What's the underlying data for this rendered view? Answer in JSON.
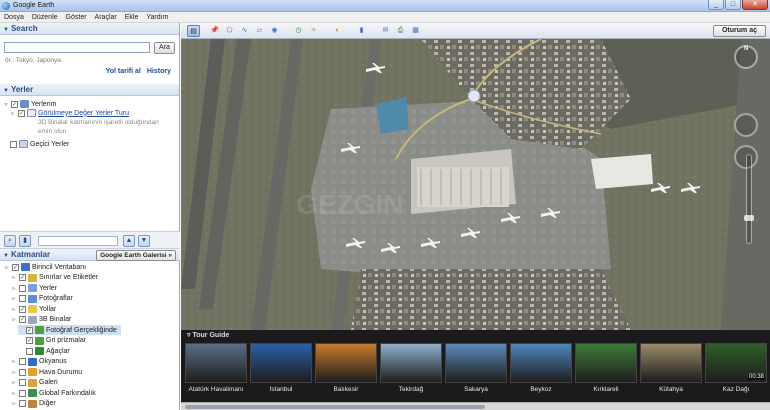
{
  "window": {
    "title": "Google Earth",
    "min": "_",
    "max": "□",
    "close": "✕"
  },
  "menu": [
    "Dosya",
    "Düzenle",
    "Göster",
    "Araçlar",
    "Ekle",
    "Yardım"
  ],
  "search": {
    "header": "Search",
    "placeholder": "",
    "button": "Ara",
    "hint": "ör.: Tokyo, Japonya",
    "link_directions": "Yol tarifi al",
    "link_history": "History"
  },
  "places": {
    "header": "Yerler",
    "items": [
      {
        "label": "Yerlerim",
        "checked": true
      },
      {
        "label": "Görülmeye Değer Yerler Turu",
        "checked": true,
        "link": true
      },
      {
        "label": "3D Binalar katmanının işaretli olduğundan",
        "sub": true
      },
      {
        "label": "emin olun",
        "sub": true
      },
      {
        "label": "Geçici Yerler",
        "checked": false
      }
    ]
  },
  "layers": {
    "header": "Katmanlar",
    "gallery_button": "Google Earth Galerisi »",
    "items": [
      {
        "label": "Birincil Veritabanı",
        "checked": true,
        "level": 0,
        "color": "#3b6fc4"
      },
      {
        "label": "Sınırlar ve Etiketler",
        "checked": true,
        "level": 1,
        "color": "#d8b23a"
      },
      {
        "label": "Yerler",
        "checked": false,
        "level": 1,
        "color": "#7aa0d8"
      },
      {
        "label": "Fotoğraflar",
        "checked": false,
        "level": 1,
        "color": "#5d8fd6"
      },
      {
        "label": "Yollar",
        "checked": true,
        "level": 1,
        "color": "#ebc64a"
      },
      {
        "label": "3B Binalar",
        "checked": true,
        "level": 1,
        "color": "#9aa7b5"
      },
      {
        "label": "Fotoğraf Gerçekliğinde",
        "checked": true,
        "level": 2,
        "color": "#4aa33a",
        "selected": true
      },
      {
        "label": "Gri prizmalar",
        "checked": true,
        "level": 2,
        "color": "#4aa33a"
      },
      {
        "label": "Ağaçlar",
        "checked": false,
        "level": 2,
        "color": "#2f8a2f"
      },
      {
        "label": "Okyanus",
        "checked": false,
        "level": 1,
        "color": "#2f6cc8"
      },
      {
        "label": "Hava Durumu",
        "checked": false,
        "level": 1,
        "color": "#e0a12c"
      },
      {
        "label": "Galeri",
        "checked": false,
        "level": 1,
        "color": "#d9a63e"
      },
      {
        "label": "Global Farkındalık",
        "checked": false,
        "level": 1,
        "color": "#3c8f53"
      },
      {
        "label": "Diğer",
        "checked": false,
        "level": 1,
        "color": "#c0853a"
      }
    ]
  },
  "toolbar": {
    "icons": [
      "sidebar-icon",
      "placemark-icon",
      "polygon-icon",
      "path-icon",
      "overlay-icon",
      "tour-icon",
      "historical-imagery-icon",
      "sun-icon",
      "planets-icon",
      "ruler-icon",
      "email-icon",
      "print-icon",
      "view-in-maps-icon"
    ],
    "signin": "Oturum aç"
  },
  "map": {
    "watermark": "GEZGIN"
  },
  "tour": {
    "header": "Tour Guide",
    "items": [
      {
        "caption": "Atatürk Havalimanı",
        "color": "#5a6f86"
      },
      {
        "caption": "İstanbul",
        "color": "#2b5fa8"
      },
      {
        "caption": "Balıkesir",
        "color": "#c97a2c"
      },
      {
        "caption": "Tekirdağ",
        "color": "#8fb0cc"
      },
      {
        "caption": "Sakarya",
        "color": "#5c8ab8"
      },
      {
        "caption": "Beykoz",
        "color": "#4f88c0"
      },
      {
        "caption": "Kırklareli",
        "color": "#3e7b3a"
      },
      {
        "caption": "Kütahya",
        "color": "#9a8a6a"
      },
      {
        "caption": "Kaz Dağı",
        "color": "#2f5f2a"
      }
    ],
    "duration": "00:38"
  }
}
